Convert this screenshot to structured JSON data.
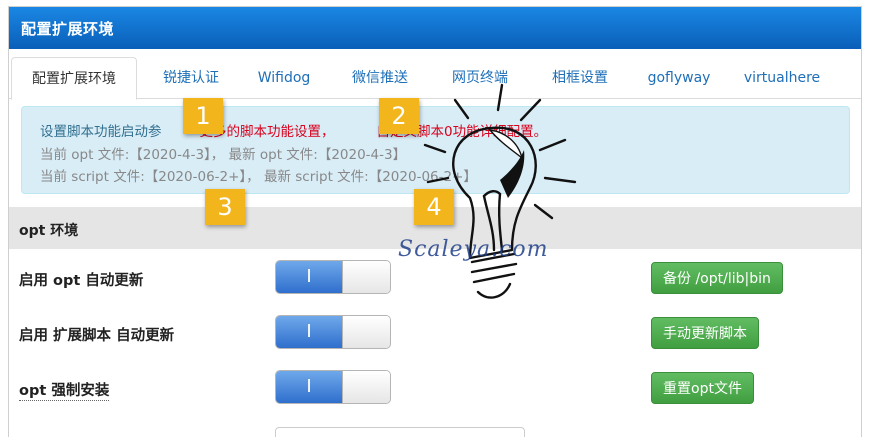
{
  "window": {
    "title": "配置扩展环境"
  },
  "tabs": [
    {
      "label": "配置扩展环境"
    },
    {
      "label": "锐捷认证"
    },
    {
      "label": "Wifidog"
    },
    {
      "label": "微信推送"
    },
    {
      "label": "网页终端"
    },
    {
      "label": "相框设置"
    },
    {
      "label": "goflyway"
    },
    {
      "label": "virtualhere"
    }
  ],
  "info": {
    "line1_prefix": "设置脚本功能启动参",
    "line1_red_a": "更多的脚本功能设置，",
    "line1_red_b": "自定义脚本0功能详细配置。",
    "line2": "当前 opt 文件:【2020-4-3】， 最新 opt 文件:【2020-4-3】",
    "line3": "当前 script 文件:【2020-06-2+】， 最新 script 文件:【2020-06-2+】"
  },
  "section": {
    "title": "opt 环境"
  },
  "rows": [
    {
      "label": "启用 opt 自动更新",
      "toggle_on_text": "I",
      "button": "备份 /opt/lib|bin"
    },
    {
      "label": "启用 扩展脚本 自动更新",
      "toggle_on_text": "I",
      "button": "手动更新脚本"
    },
    {
      "label": "opt 强制安装",
      "toggle_on_text": "I",
      "button": "重置opt文件"
    }
  ],
  "badges": [
    "1",
    "2",
    "3",
    "4"
  ],
  "watermark": "Scaleya.com",
  "colors": {
    "header": "#1477d6",
    "accent_blue": "#2f6fcd",
    "button_green": "#4cae4c",
    "badge": "#f2b51b",
    "warning_red": "#d9001b"
  }
}
